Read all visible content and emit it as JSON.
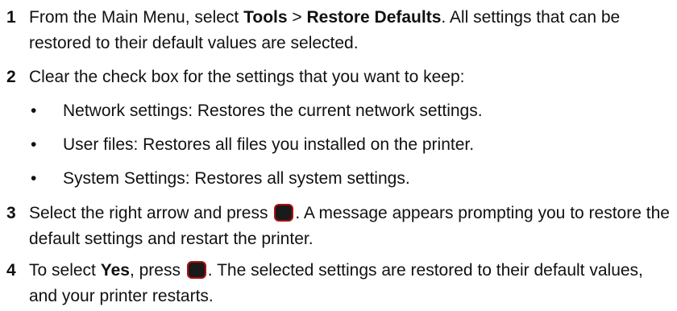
{
  "steps": [
    {
      "number": "1",
      "text_a": "From the Main Menu, select ",
      "bold_a": "Tools",
      "text_b": " > ",
      "bold_b": "Restore Defaults",
      "text_c": ". All settings that can be restored to their default values are selected."
    },
    {
      "number": "2",
      "text": "Clear the check box for the settings that you want to keep:",
      "bullets": [
        "Network settings: Restores the current network settings.",
        "User files: Restores all files you installed on the printer.",
        "System Settings: Restores all system settings."
      ]
    },
    {
      "number": "3",
      "text_a": "Select the right arrow and press ",
      "text_b": ". A message appears prompting you to restore the default settings and restart the printer."
    },
    {
      "number": "4",
      "text_a": "To select ",
      "bold_a": "Yes",
      "text_b": ", press ",
      "text_c": ". The selected settings are restored to their default values, and your printer restarts."
    }
  ],
  "bullet_glyph": "•",
  "icons": {
    "key_button": "select-button-icon"
  },
  "colors": {
    "text": "#111111",
    "button_fill": "#1a1a1a",
    "button_border": "#b01010"
  }
}
